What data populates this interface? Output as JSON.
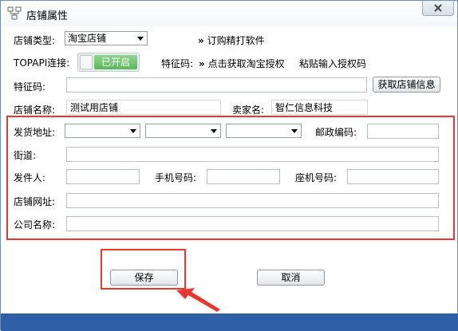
{
  "window": {
    "title": "店铺属性"
  },
  "shop_type": {
    "label": "店铺类型:",
    "value": "淘宝店铺"
  },
  "subscribe_link": "订购精打软件",
  "topapi": {
    "label": "TOPAPI连接:",
    "status": "已开启"
  },
  "feature": {
    "label": "特征码:",
    "get_auth_link": "点击获取淘宝授权",
    "paste_link": "粘贴输入授权码",
    "field_label": "特征码:",
    "value": "",
    "fetch_button": "获取店铺信息"
  },
  "shop_name": {
    "label": "店铺名称:",
    "value": "测试用店铺"
  },
  "seller_name": {
    "label": "卖家名:",
    "value": "智仁信息科技"
  },
  "shipping": {
    "address_label": "发货地址:",
    "province": "",
    "city": "",
    "district": "",
    "zip_label": "邮政编码:",
    "zip_value": "",
    "street_label": "街道:",
    "street_value": "",
    "sender_label": "发件人:",
    "sender_value": "",
    "mobile_label": "手机号码:",
    "mobile_value": "",
    "phone_label": "座机号码:",
    "phone_value": "",
    "shop_url_label": "店铺网址:",
    "shop_url_value": "",
    "company_label": "公司名称:",
    "company_value": ""
  },
  "buttons": {
    "save": "保存",
    "cancel": "取消"
  },
  "colors": {
    "highlight": "#e8382f",
    "toggle_on": "#5cb85c",
    "bottom_bar": "#2f5fa6"
  }
}
